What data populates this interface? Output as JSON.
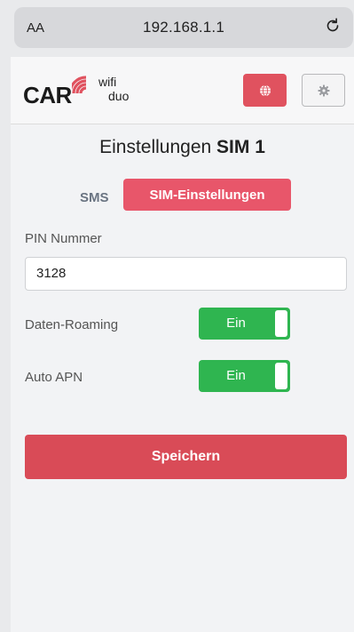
{
  "browser": {
    "text_size_label": "AA",
    "url": "192.168.1.1"
  },
  "header": {
    "logo": {
      "car": "CAR",
      "wifi": "wifi",
      "duo": "duo"
    },
    "lang_button_color": "#e0525f"
  },
  "page": {
    "title_prefix": "Einstellungen",
    "title_sim": "SIM 1"
  },
  "tabs": {
    "sms_label": "SMS",
    "sim_label": "SIM-Einstellungen",
    "active": "SIM-Einstellungen"
  },
  "form": {
    "pin_label": "PIN Nummer",
    "pin_value": "3128",
    "roaming_label": "Daten-Roaming",
    "roaming_toggle": "Ein",
    "apn_label": "Auto APN",
    "apn_toggle": "Ein"
  },
  "actions": {
    "save_label": "Speichern"
  },
  "colors": {
    "accent_red": "#e8566a",
    "save_red": "#d94b57",
    "toggle_green": "#2fb550"
  }
}
